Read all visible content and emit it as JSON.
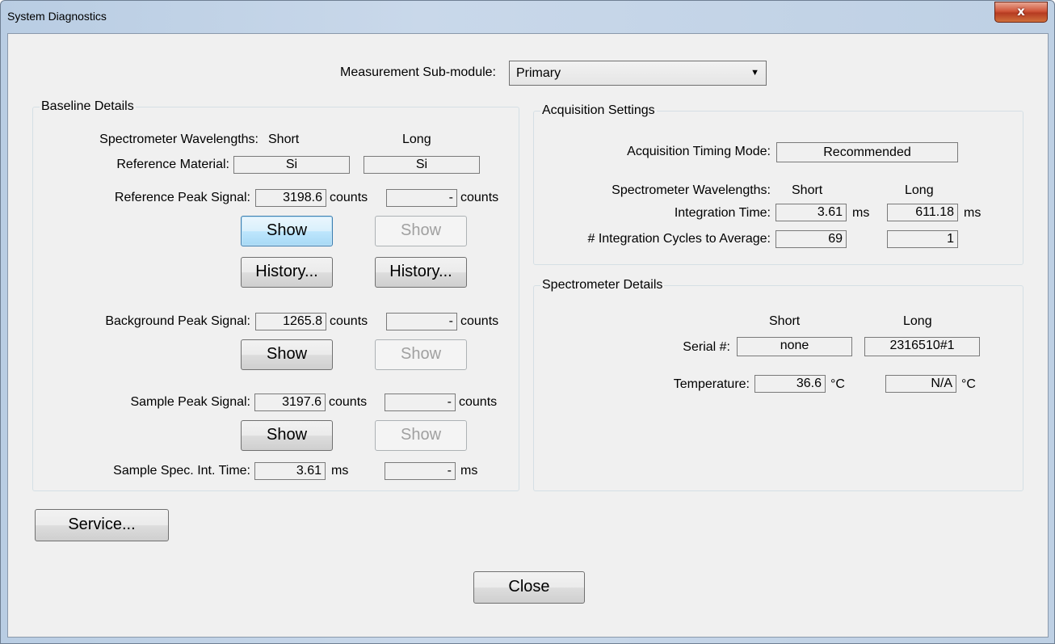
{
  "window": {
    "title": "System Diagnostics",
    "close_glyph": "x"
  },
  "header": {
    "label": "Measurement Sub-module:",
    "selected": "Primary"
  },
  "baseline": {
    "title": "Baseline Details",
    "wavelengths_label": "Spectrometer Wavelengths:",
    "short": "Short",
    "long": "Long",
    "ref_material_label": "Reference Material:",
    "ref_material_short": "Si",
    "ref_material_long": "Si",
    "ref_peak_label": "Reference Peak Signal:",
    "ref_peak_short": "3198.6",
    "ref_peak_long": "-",
    "counts": "counts",
    "show": "Show",
    "history": "History...",
    "bg_peak_label": "Background Peak Signal:",
    "bg_peak_short": "1265.8",
    "bg_peak_long": "-",
    "sample_peak_label": "Sample Peak Signal:",
    "sample_peak_short": "3197.6",
    "sample_peak_long": "-",
    "sample_int_label": "Sample Spec. Int. Time:",
    "sample_int_short": "3.61",
    "sample_int_long": "-",
    "ms": "ms"
  },
  "acquisition": {
    "title": "Acquisition Settings",
    "timing_label": "Acquisition Timing Mode:",
    "timing_value": "Recommended",
    "wavelengths_label": "Spectrometer Wavelengths:",
    "short": "Short",
    "long": "Long",
    "integration_label": "Integration Time:",
    "integration_short": "3.61",
    "integration_long": "611.18",
    "ms": "ms",
    "cycles_label": "# Integration Cycles to Average:",
    "cycles_short": "69",
    "cycles_long": "1"
  },
  "spectrometer": {
    "title": "Spectrometer Details",
    "short": "Short",
    "long": "Long",
    "serial_label": "Serial #:",
    "serial_short": "none",
    "serial_long": "2316510#1",
    "temp_label": "Temperature:",
    "temp_short": "36.6",
    "temp_long": "N/A",
    "celsius": "°C"
  },
  "footer": {
    "service": "Service...",
    "close": "Close"
  }
}
